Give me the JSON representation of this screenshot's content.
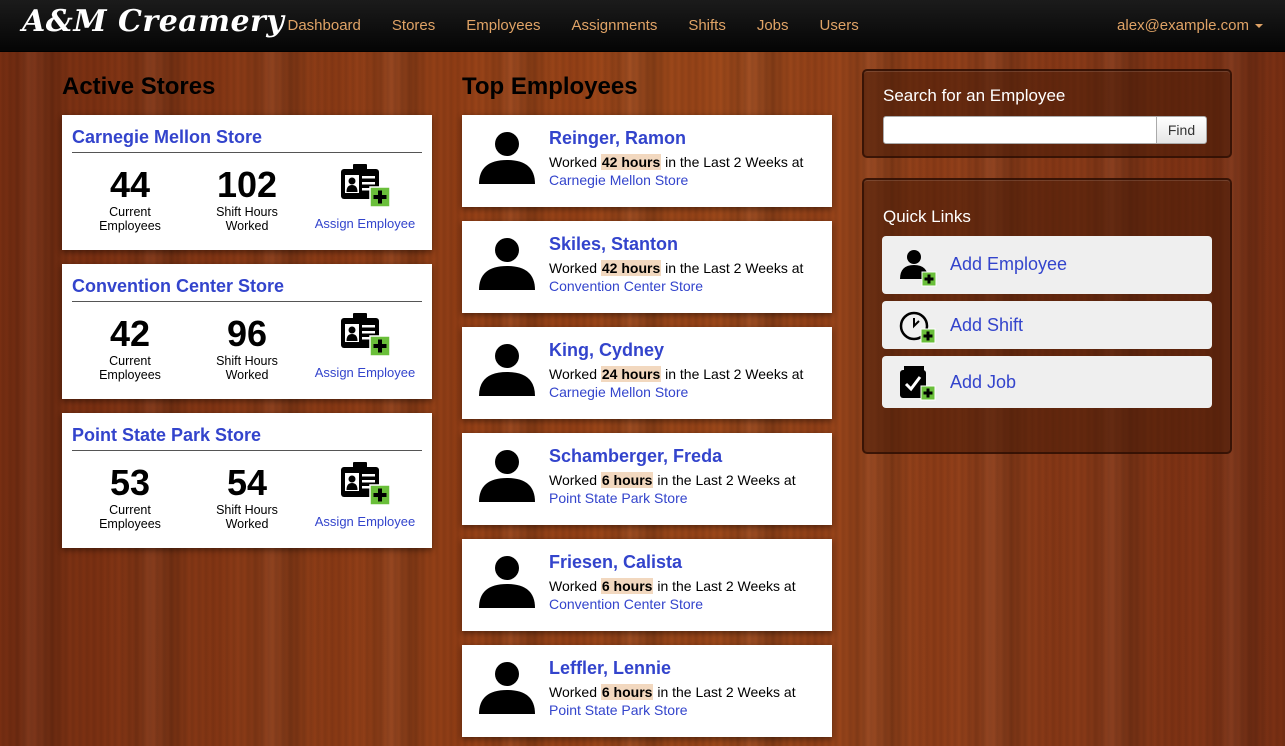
{
  "navbar": {
    "brand": "A&M Creamery",
    "links": [
      "Dashboard",
      "Stores",
      "Employees",
      "Assignments",
      "Shifts",
      "Jobs",
      "Users"
    ],
    "user": "alex@example.com"
  },
  "stores": {
    "heading": "Active Stores",
    "cards": [
      {
        "name": "Carnegie Mellon Store",
        "employees": "44",
        "employees_label_1": "Current",
        "employees_label_2": "Employees",
        "hours": "102",
        "hours_label_1": "Shift Hours",
        "hours_label_2": "Worked",
        "assign_label": "Assign Employee"
      },
      {
        "name": "Convention Center Store",
        "employees": "42",
        "employees_label_1": "Current",
        "employees_label_2": "Employees",
        "hours": "96",
        "hours_label_1": "Shift Hours",
        "hours_label_2": "Worked",
        "assign_label": "Assign Employee"
      },
      {
        "name": "Point State Park Store",
        "employees": "53",
        "employees_label_1": "Current",
        "employees_label_2": "Employees",
        "hours": "54",
        "hours_label_1": "Shift Hours",
        "hours_label_2": "Worked",
        "assign_label": "Assign Employee"
      }
    ]
  },
  "employees": {
    "heading": "Top Employees",
    "worked_prefix": "Worked",
    "worked_suffix": "in the Last 2 Weeks at",
    "cards": [
      {
        "name": "Reinger, Ramon",
        "hours": "42 hours",
        "store": "Carnegie Mellon Store"
      },
      {
        "name": "Skiles, Stanton",
        "hours": "42 hours",
        "store": "Convention Center Store"
      },
      {
        "name": "King, Cydney",
        "hours": "24 hours",
        "store": "Carnegie Mellon Store"
      },
      {
        "name": "Schamberger, Freda",
        "hours": "6 hours",
        "store": "Point State Park Store"
      },
      {
        "name": "Friesen, Calista",
        "hours": "6 hours",
        "store": "Convention Center Store"
      },
      {
        "name": "Leffler, Lennie",
        "hours": "6 hours",
        "store": "Point State Park Store"
      }
    ]
  },
  "search": {
    "title": "Search for an Employee",
    "value": "",
    "button": "Find"
  },
  "quick_links": {
    "title": "Quick Links",
    "items": [
      {
        "label": "Add Employee",
        "icon": "add-employee-icon"
      },
      {
        "label": "Add Shift",
        "icon": "add-shift-icon"
      },
      {
        "label": "Add Job",
        "icon": "add-job-icon"
      }
    ]
  },
  "colors": {
    "nav_link": "#e0a366",
    "link_blue": "#3344cc",
    "plus_green": "#6abf3a",
    "hours_highlight": "#f2d8bf"
  }
}
